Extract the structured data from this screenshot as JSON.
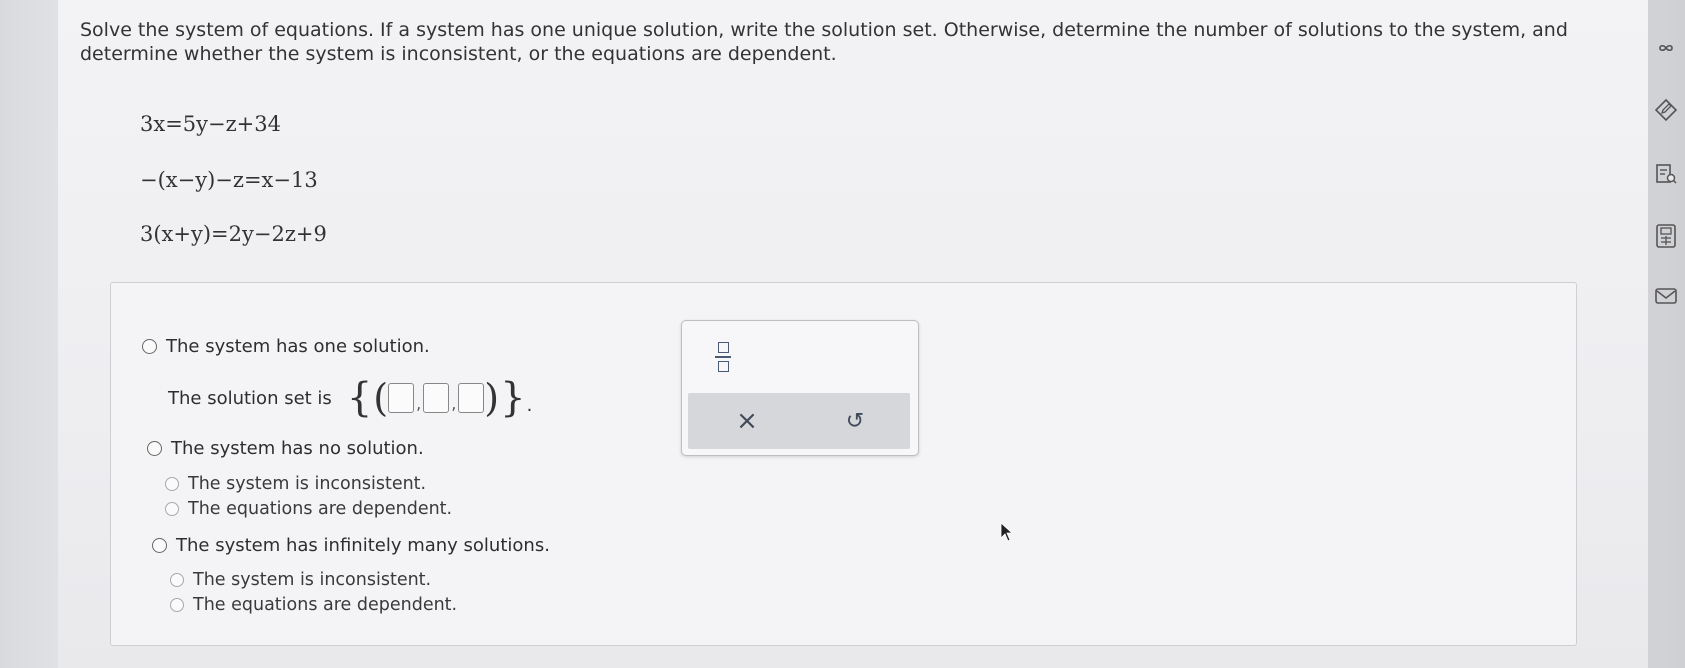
{
  "instructions": "Solve the system of equations. If a system has one unique solution, write the solution set. Otherwise, determine the number of solutions to the system, and determine whether the system is inconsistent, or the equations are dependent.",
  "equations": [
    "3x=5y−z+34",
    "−(x−y)−z=x−13",
    "3(x+y)=2y−2z+9"
  ],
  "options": {
    "one_solution": "The system has one solution.",
    "solution_set_label": "The solution set is",
    "no_solution": "The system has no solution.",
    "no_solution_sub": [
      "The system is inconsistent.",
      "The equations are dependent."
    ],
    "infinite": "The system has infinitely many solutions.",
    "infinite_sub": [
      "The system is inconsistent.",
      "The equations are dependent."
    ]
  },
  "palette": {
    "clear_label": "×",
    "undo_label": "↺",
    "fraction_icon": "fraction-icon"
  },
  "side_toolbar": [
    "infinity-icon",
    "edit-icon",
    "document-search-icon",
    "calculator-icon",
    "mail-icon"
  ]
}
